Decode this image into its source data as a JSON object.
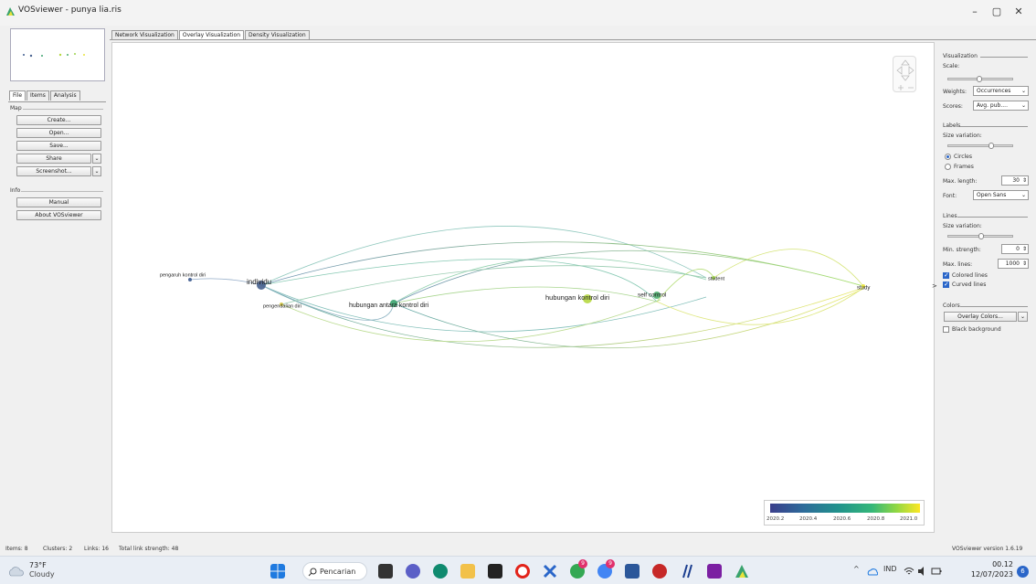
{
  "window": {
    "title": "VOSviewer - punya lia.ris",
    "minimize": "–",
    "maximize": "▢",
    "close": "✕"
  },
  "left_panel": {
    "tabs": [
      "File",
      "Items",
      "Analysis"
    ],
    "map_section": "Map",
    "map_buttons": [
      "Create...",
      "Open...",
      "Save...",
      "Share",
      "Screenshot..."
    ],
    "dropdown_arrow": "⌄",
    "info_section": "Info",
    "info_buttons": [
      "Manual",
      "About VOSviewer"
    ]
  },
  "main_tabs": [
    "Network Visualization",
    "Overlay Visualization",
    "Density Visualization"
  ],
  "active_main_tab": "Overlay Visualization",
  "map": {
    "nodes": [
      {
        "label": "pengaruh kontrol diri",
        "size": 2,
        "color": "#3d5a8e"
      },
      {
        "label": "individu",
        "size": 5,
        "color": "#46608e"
      },
      {
        "label": "pengendalian diri",
        "size": 2,
        "color": "#d6c945"
      },
      {
        "label": "hubungan antara kontrol diri",
        "size": 4,
        "color": "#3aa36e"
      },
      {
        "label": "hubungan kontrol diri",
        "size": 5,
        "color": "#b6d840"
      },
      {
        "label": "self control",
        "size": 4,
        "color": "#4caf6e"
      },
      {
        "label": "student",
        "size": 2,
        "color": "#9bd24a"
      },
      {
        "label": "study",
        "size": 2,
        "color": "#e9e23a"
      }
    ]
  },
  "legend": {
    "ticks": [
      "2020.2",
      "2020.4",
      "2020.6",
      "2020.8",
      "2021.0"
    ]
  },
  "right_panel": {
    "visualization": "Visualization",
    "scale": "Scale:",
    "weights_label": "Weights:",
    "weights_value": "Occurrences",
    "scores_label": "Scores:",
    "scores_value": "Avg. pub....",
    "labels_section": "Labels",
    "size_variation": "Size variation:",
    "circles": "Circles",
    "frames": "Frames",
    "max_length_label": "Max. length:",
    "max_length_value": "30",
    "font_label": "Font:",
    "font_value": "Open Sans",
    "lines_section": "Lines",
    "lines_size_variation": "Size variation:",
    "min_strength_label": "Min. strength:",
    "min_strength_value": "0",
    "max_lines_label": "Max. lines:",
    "max_lines_value": "1000",
    "colored_lines": "Colored lines",
    "curved_lines": "Curved lines",
    "colors_section": "Colors",
    "overlay_colors": "Overlay Colors...",
    "black_background": "Black background",
    "collapse_arrow": ">",
    "spin_arrows": "⇕",
    "dropdown_arrow": "⌄"
  },
  "status_bar": {
    "items": "Items: 8",
    "clusters": "Clusters: 2",
    "links": "Links: 16",
    "total_link_strength": "Total link strength: 48",
    "version": "VOSviewer version 1.6.19"
  },
  "taskbar": {
    "temperature": "73°F",
    "condition": "Cloudy",
    "search": "Pencarian",
    "language": "IND",
    "time": "00.12",
    "date": "12/07/2023",
    "notifications": "6",
    "badge_1": "9",
    "badge_2": "9",
    "tray_arrow": "^"
  }
}
